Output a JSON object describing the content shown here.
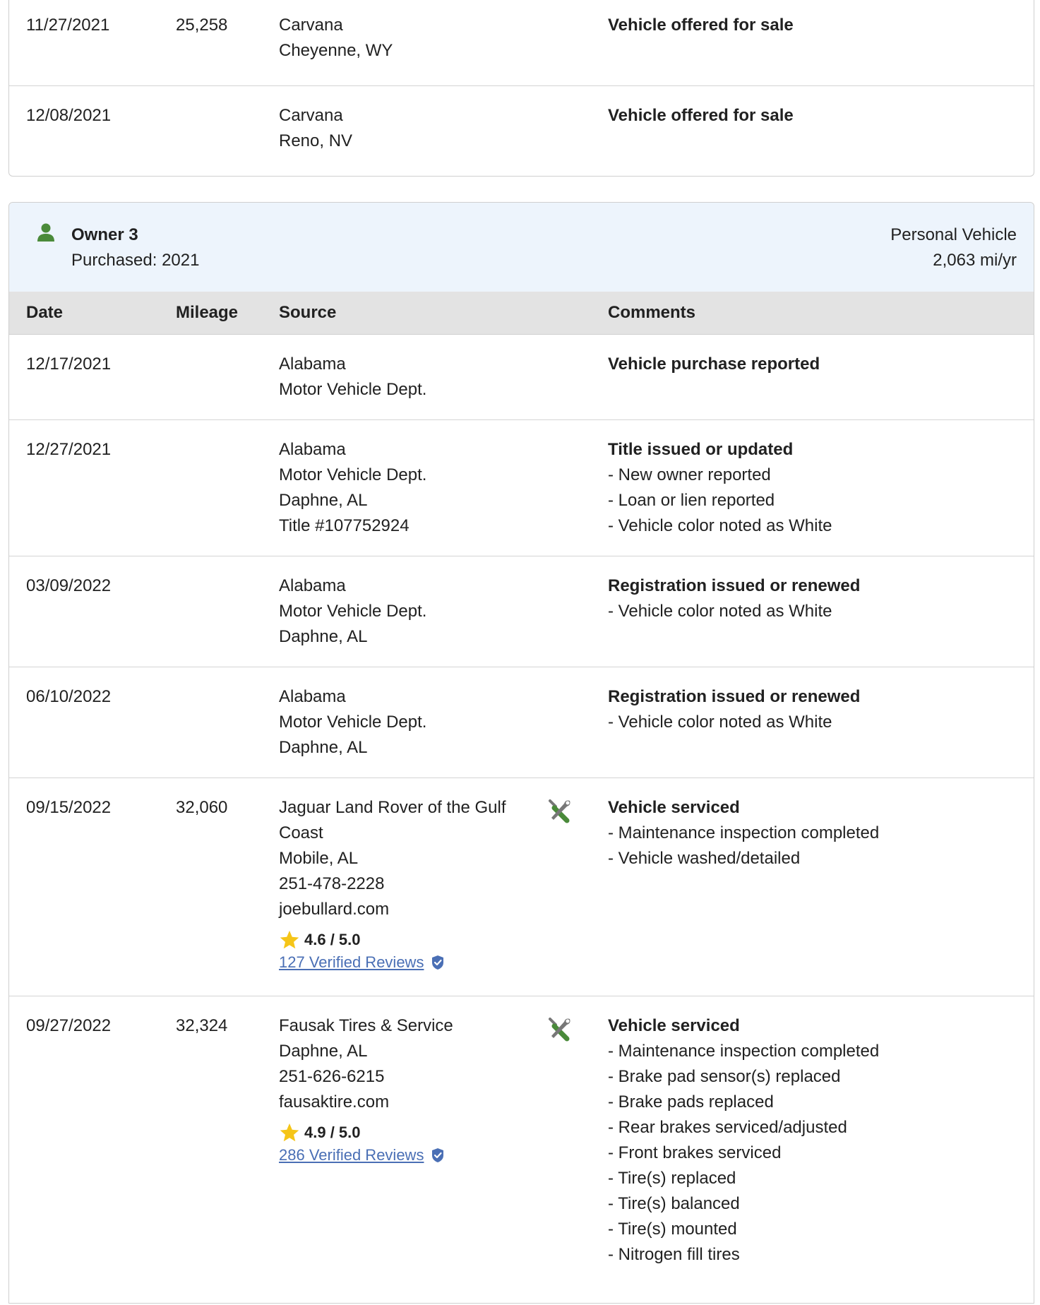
{
  "top_rows": [
    {
      "date": "11/27/2021",
      "mileage": "25,258",
      "source": [
        "Carvana",
        "Cheyenne, WY"
      ],
      "title": "Vehicle offered for sale",
      "details": []
    },
    {
      "date": "12/08/2021",
      "mileage": "",
      "source": [
        "Carvana",
        "Reno, NV"
      ],
      "title": "Vehicle offered for sale",
      "details": []
    }
  ],
  "owner": {
    "title": "Owner 3",
    "purchased": "Purchased: 2021",
    "type": "Personal Vehicle",
    "rate": "2,063 mi/yr"
  },
  "columns": {
    "date": "Date",
    "mileage": "Mileage",
    "source": "Source",
    "comments": "Comments"
  },
  "rows": [
    {
      "date": "12/17/2021",
      "mileage": "",
      "source": [
        "Alabama",
        "Motor Vehicle Dept."
      ],
      "title": "Vehicle purchase reported",
      "details": []
    },
    {
      "date": "12/27/2021",
      "mileage": "",
      "source": [
        "Alabama",
        "Motor Vehicle Dept.",
        "Daphne, AL",
        "Title #107752924"
      ],
      "title": "Title issued or updated",
      "details": [
        "- New owner reported",
        "- Loan or lien reported",
        "- Vehicle color noted as White"
      ]
    },
    {
      "date": "03/09/2022",
      "mileage": "",
      "source": [
        "Alabama",
        "Motor Vehicle Dept.",
        "Daphne, AL"
      ],
      "title": "Registration issued or renewed",
      "details": [
        "- Vehicle color noted as White"
      ]
    },
    {
      "date": "06/10/2022",
      "mileage": "",
      "source": [
        "Alabama",
        "Motor Vehicle Dept.",
        "Daphne, AL"
      ],
      "title": "Registration issued or renewed",
      "details": [
        "- Vehicle color noted as White"
      ]
    },
    {
      "date": "09/15/2022",
      "mileage": "32,060",
      "source": [
        "Jaguar Land Rover of the Gulf",
        "Coast",
        "Mobile, AL",
        "251-478-2228",
        "joebullard.com"
      ],
      "rating": "4.6 / 5.0",
      "reviews": "127 Verified Reviews",
      "service": true,
      "title": "Vehicle serviced",
      "details": [
        "- Maintenance inspection completed",
        "- Vehicle washed/detailed"
      ]
    },
    {
      "date": "09/27/2022",
      "mileage": "32,324",
      "source": [
        "Fausak Tires & Service",
        "Daphne, AL",
        "251-626-6215",
        "fausaktire.com"
      ],
      "rating": "4.9 / 5.0",
      "reviews": "286 Verified Reviews",
      "service": true,
      "title": "Vehicle serviced",
      "details": [
        "- Maintenance inspection completed",
        "- Brake pad sensor(s) replaced",
        "- Brake pads replaced",
        "- Rear brakes serviced/adjusted",
        "- Front brakes serviced",
        "- Tire(s) replaced",
        "- Tire(s) balanced",
        "- Tire(s) mounted",
        "- Nitrogen fill tires"
      ]
    }
  ],
  "colors": {
    "service_icon": "#4a8a3a",
    "star": "#f5c518",
    "badge": "#4a6fb5",
    "owner_icon": "#4a8a3a"
  }
}
